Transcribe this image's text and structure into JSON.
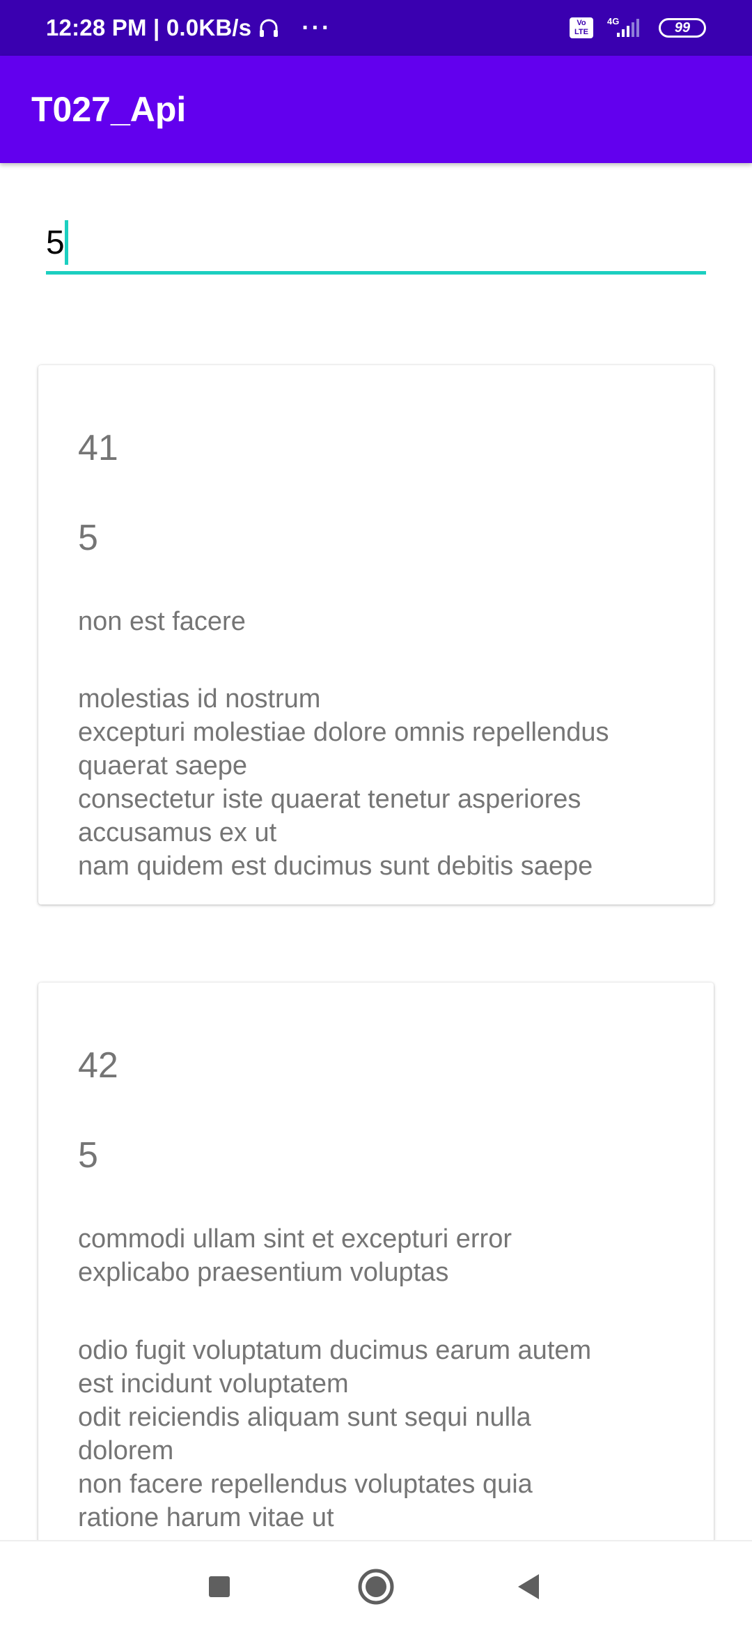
{
  "status_bar": {
    "time_speed": "12:28 PM | 0.0KB/s",
    "more": "···",
    "volte": "Vo LTE",
    "network": "4G",
    "battery": "99"
  },
  "app_bar": {
    "title": "T027_Api"
  },
  "search": {
    "value": "5"
  },
  "posts": [
    {
      "id": "41",
      "user_id": "5",
      "title": "non est facere",
      "body": "molestias id nostrum\nexcepturi molestiae dolore omnis repellendus\nquaerat saepe\nconsectetur iste quaerat tenetur asperiores\naccusamus ex ut\nnam quidem est ducimus sunt debitis saepe"
    },
    {
      "id": "42",
      "user_id": "5",
      "title": "commodi ullam sint et excepturi error\nexplicabo praesentium voluptas",
      "body": "odio fugit voluptatum ducimus earum autem\nest incidunt voluptatem\nodit reiciendis aliquam sunt sequi nulla\ndolorem\nnon facere repellendus voluptates quia\nratione harum vitae ut"
    }
  ],
  "nav": {
    "icons": [
      "recents-square-icon",
      "home-circle-icon",
      "back-triangle-icon"
    ]
  }
}
